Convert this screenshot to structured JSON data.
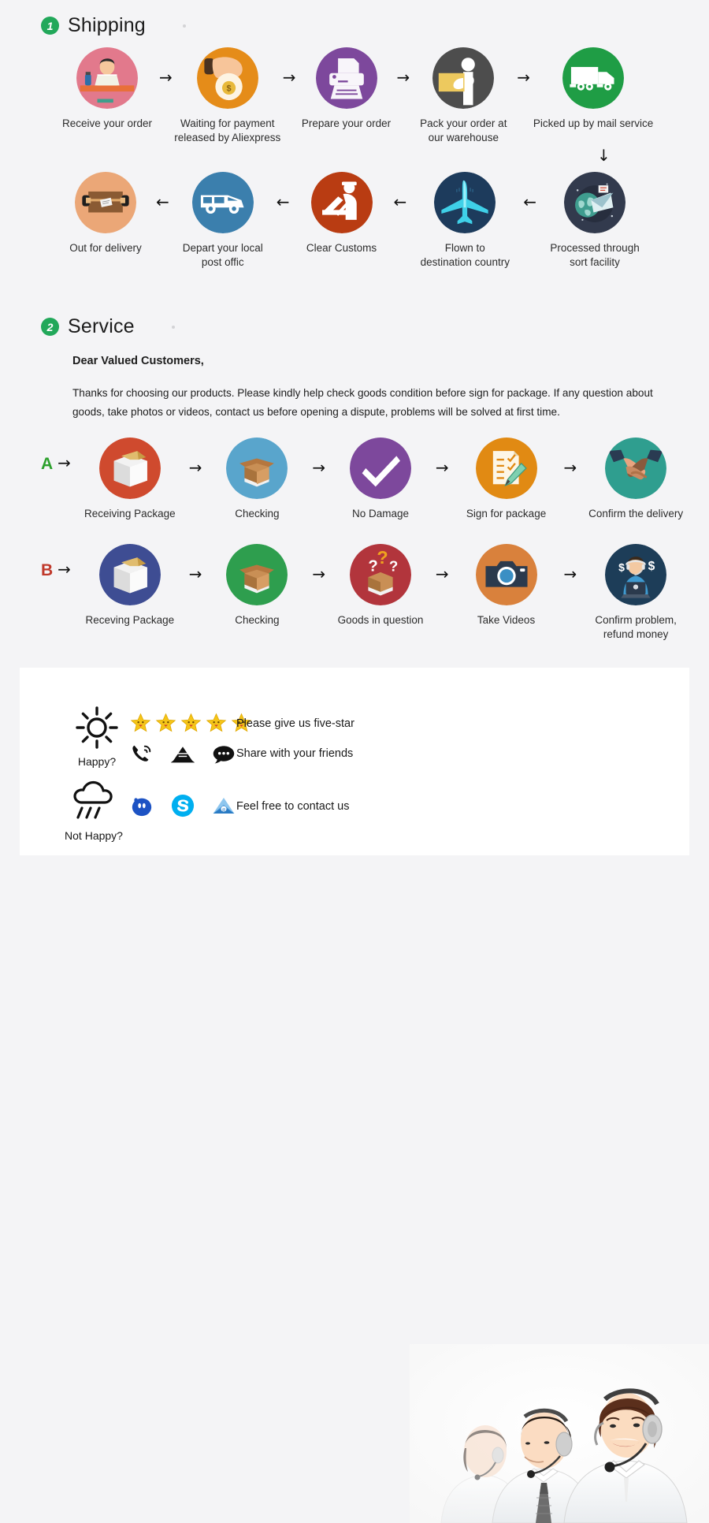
{
  "page": {
    "background": "#f4f4f6",
    "card_background": "#ffffff",
    "badge_color": "#22a85a"
  },
  "shipping": {
    "number": "1",
    "title": "Shipping",
    "row1": [
      {
        "label": "Receive your order",
        "icon": "person-at-laptop-icon",
        "color": "#e2798c"
      },
      {
        "label": "Waiting for payment\nreleased by Aliexpress",
        "icon": "hand-money-bag-icon",
        "color": "#e58c19"
      },
      {
        "label": "Prepare your order",
        "icon": "printer-icon",
        "color": "#7d489c"
      },
      {
        "label": "Pack your order at\nour warehouse",
        "icon": "worker-packing-icon",
        "color": "#4d4d4d"
      },
      {
        "label": "Picked up by mail service",
        "icon": "delivery-truck-icon",
        "color": "#1f9d45"
      }
    ],
    "row2": [
      {
        "label": "Out for delivery",
        "icon": "parcel-box-icon",
        "color": "#eba777"
      },
      {
        "label": "Depart your local\npost offic",
        "icon": "delivery-van-icon",
        "color": "#3b7fad"
      },
      {
        "label": "Clear  Customs",
        "icon": "customs-officer-icon",
        "color": "#b93c12"
      },
      {
        "label": "Flown to\ndestination country",
        "icon": "airplane-icon",
        "color": "#1d3b5c"
      },
      {
        "label": "Processed through\nsort facility",
        "icon": "globe-mail-icon",
        "color": "#323a4d"
      }
    ],
    "arrow_right": "→",
    "arrow_left": "←",
    "arrow_down": "↓"
  },
  "service": {
    "number": "2",
    "title": "Service",
    "greeting": "Dear Valued Customers,",
    "paragraph": "Thanks for choosing our products. Please kindly help check goods condition before sign for package. If any question about goods, take photos or videos, contact us before opening a dispute, problems will be solved at first time.",
    "rowA": {
      "letter": "A",
      "letter_color": "#2ca02c",
      "steps": [
        {
          "label": "Receiving Package",
          "icon": "sealed-carton-icon",
          "color": "#cf4a2e"
        },
        {
          "label": "Checking",
          "icon": "open-carton-icon",
          "color": "#59a5cc"
        },
        {
          "label": "No Damage",
          "icon": "check-mark-icon",
          "color": "#7d489c"
        },
        {
          "label": "Sign for package",
          "icon": "sign-document-icon",
          "color": "#e18a13"
        },
        {
          "label": "Confirm the delivery",
          "icon": "handshake-icon",
          "color": "#2f9e8f"
        }
      ]
    },
    "rowB": {
      "letter": "B",
      "letter_color": "#c0392b",
      "steps": [
        {
          "label": "Receving Package",
          "icon": "sealed-carton-icon",
          "color": "#3e4d93"
        },
        {
          "label": "Checking",
          "icon": "open-carton-icon",
          "color": "#2e9e4e"
        },
        {
          "label": "Goods in question",
          "icon": "question-box-icon",
          "color": "#b2353c"
        },
        {
          "label": "Take Videos",
          "icon": "camera-icon",
          "color": "#d9813c"
        },
        {
          "label": "Confirm problem,\nrefund money",
          "icon": "support-agent-money-icon",
          "color": "#1d3d58"
        }
      ]
    },
    "arrow_right": "→"
  },
  "footer": {
    "happy": {
      "icon": "sun-icon",
      "label": "Happy?",
      "line1": {
        "icon_count": 5,
        "icon": "smiley-star-icon",
        "text": "Please give us five-star"
      },
      "line2": {
        "icons": [
          "phone-ring-icon",
          "mail-envelope-icon",
          "chat-bubble-icon"
        ],
        "text": "Share with your friends"
      }
    },
    "not_happy": {
      "icon": "rain-cloud-icon",
      "label": "Not Happy?",
      "line1": {
        "icons": [
          "qq-messenger-icon",
          "skype-icon",
          "email-envelope-icon"
        ],
        "text": "Feel free to contact us"
      }
    },
    "photo": {
      "name": "customer-service-agents-photo",
      "description": "Three smiling customer service agents wearing headsets"
    }
  }
}
